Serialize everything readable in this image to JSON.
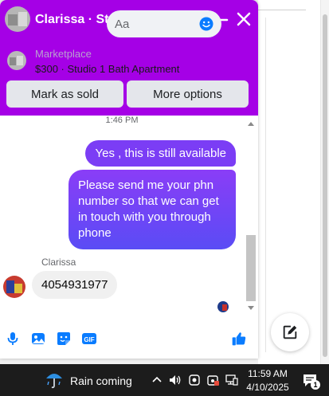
{
  "chat": {
    "title": "Clarissa · Studio 1 Bath Ap ...",
    "listing_label": "Marketplace",
    "listing_desc": "$300 · Studio 1 Bath Apartment",
    "mark_sold_label": "Mark as sold",
    "more_options_label": "More options",
    "timestamp": "1:46 PM",
    "messages": [
      {
        "from": "me",
        "text": "Yes , this is still available"
      },
      {
        "from": "me",
        "text": "Please send me your phn number so that we can get in touch with you through phone"
      },
      {
        "from": "Clarissa",
        "text": "4054931977"
      }
    ],
    "sender_name": "Clarissa",
    "composer_placeholder": "Aa",
    "icons": [
      "microphone-icon",
      "photo-icon",
      "sticker-icon",
      "gif-icon",
      "emoji-icon",
      "thumbs-up-icon",
      "minimize-icon",
      "close-icon",
      "chevron-down-icon",
      "compose-icon"
    ],
    "gif_label": "GIF"
  },
  "colors": {
    "header": "#a500e6",
    "bubble_out": "#7b3df5",
    "accent_icon": "#0a7cff",
    "taskbar": "#1c1c1c"
  },
  "taskbar": {
    "weather": "Rain coming",
    "time": "11:59 AM",
    "date": "4/10/2025",
    "notification_count": "1"
  }
}
